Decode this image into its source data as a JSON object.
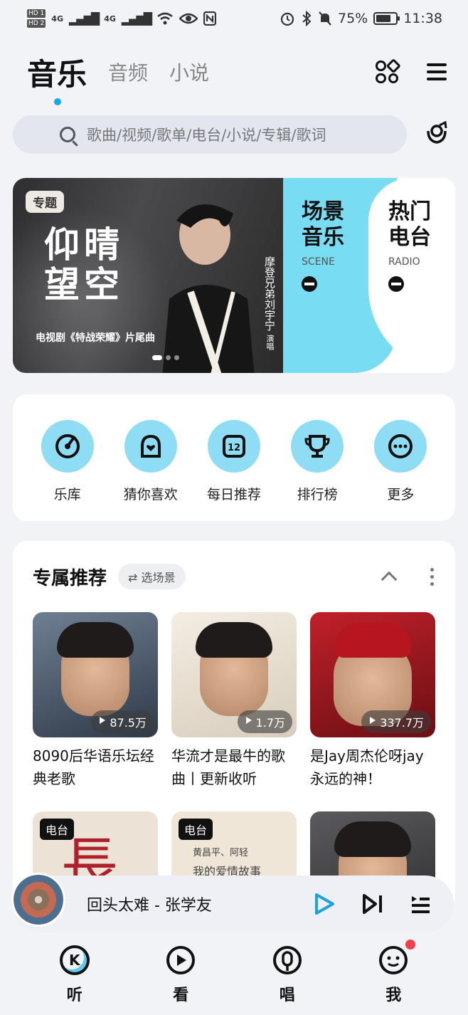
{
  "status_bar": {
    "hd1": "HD 1",
    "hd2": "HD 2",
    "net1": "4G",
    "net2": "4G",
    "battery_percent": "75%",
    "battery_level": 0.75,
    "time": "11:38"
  },
  "header": {
    "tabs": [
      {
        "label": "音乐",
        "active": true
      },
      {
        "label": "音频",
        "active": false
      },
      {
        "label": "小说",
        "active": false
      }
    ]
  },
  "search": {
    "placeholder": "歌曲/视频/歌单/电台/小说/专辑/歌词"
  },
  "banner": {
    "tag": "专题",
    "title_line1": "仰晴",
    "title_line2": "望空",
    "singer_role": "演唱",
    "singer": "摩登兄弟刘宇宁",
    "subtitle": "电视剧《特战荣耀》片尾曲",
    "scene_title": "场景音乐",
    "scene_en": "SCENE",
    "radio_title": "热门电台",
    "radio_en": "RADIO"
  },
  "quick_entries": [
    {
      "label": "乐库",
      "icon": "disc-icon"
    },
    {
      "label": "猜你喜欢",
      "icon": "heart-box-icon"
    },
    {
      "label": "每日推荐",
      "icon": "calendar-icon",
      "badge": "12"
    },
    {
      "label": "排行榜",
      "icon": "trophy-icon"
    },
    {
      "label": "更多",
      "icon": "more-icon"
    }
  ],
  "recommend": {
    "title": "专属推荐",
    "scene_button": "选场景",
    "playlists": [
      {
        "name": "8090后华语乐坛经典老歌",
        "plays": "87.5万"
      },
      {
        "name": "华流才是最牛的歌曲丨更新收听",
        "plays": "1.7万"
      },
      {
        "name": "是Jay周杰伦呀jay永远的神！",
        "plays": "337.7万"
      }
    ],
    "row2": [
      {
        "tag": "电台",
        "art": "長"
      },
      {
        "tag": "电台",
        "art_author": "黄昌平、阿轻",
        "art_title": "我的爱情故事"
      },
      {
        "tag": ""
      }
    ]
  },
  "player": {
    "now_playing": "回头太难  -  张学友"
  },
  "bottom_nav": [
    {
      "label": "听",
      "icon_letter": "K"
    },
    {
      "label": "看"
    },
    {
      "label": "唱"
    },
    {
      "label": "我"
    }
  ]
}
